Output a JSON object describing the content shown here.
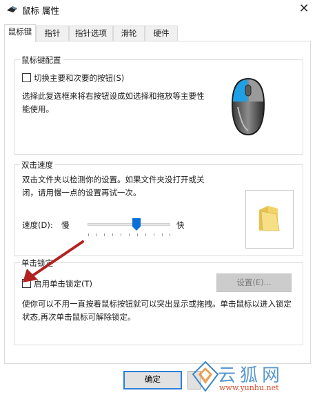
{
  "window": {
    "title": "鼠标 属性",
    "close_glyph": "✕"
  },
  "tabs": [
    {
      "label": "鼠标键",
      "active": true
    },
    {
      "label": "指针",
      "active": false
    },
    {
      "label": "指针选项",
      "active": false
    },
    {
      "label": "滑轮",
      "active": false
    },
    {
      "label": "硬件",
      "active": false
    }
  ],
  "button_config": {
    "title": "鼠标键配置",
    "switch_label": "切换主要和次要的按钮(S)",
    "switch_checked": false,
    "description": "选择此复选框来将右按钮设成如选择和拖放等主要性能使用。",
    "icon": "mouse-icon"
  },
  "double_click": {
    "title": "双击速度",
    "description": "双击文件夹以检测你的设置。如果文件夹没打开或关闭，请用慢一点的设置再试一次。",
    "speed_label": "速度(D):",
    "slow_label": "慢",
    "fast_label": "快",
    "speed_level": 0.6,
    "icon": "folder-icon"
  },
  "click_lock": {
    "title": "单击锁定",
    "enable_label": "启用单击锁定(T)",
    "enable_checked": false,
    "settings_label": "设置(E)...",
    "settings_enabled": false,
    "description": "使你可以不用一直按着鼠标按钮就可以突出显示或拖拽。单击鼠标以进入锁定状态,再次单击鼠标可解除锁定。"
  },
  "footer": {
    "ok_label": "确定"
  },
  "annotation": {
    "arrow_color": "#b22222"
  },
  "watermark": {
    "site": "www.yunhu.net",
    "brand": "云狐网"
  },
  "colors": {
    "accent": "#2b7ed8",
    "mouse_blue": "#1fa0e6",
    "folder": "#f3d36b"
  }
}
